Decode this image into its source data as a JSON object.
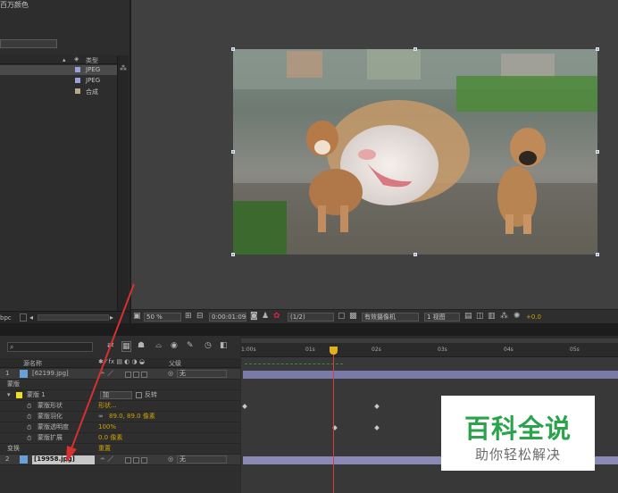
{
  "project": {
    "header_text": "百万颜色",
    "column_type": "类型",
    "items": [
      {
        "type": "JPEG",
        "color": "#9aa0d8"
      },
      {
        "type": "JPEG",
        "color": "#9aa0d8"
      },
      {
        "type": "合成",
        "color": "#b8a88a"
      }
    ],
    "bottom_label": "bpc"
  },
  "viewer": {
    "zoom": "50 %",
    "timecode": "0:00:01:09",
    "resolution": "(1/2)",
    "camera": "有效摄像机",
    "views": "1 视图",
    "exposure": "+0.0"
  },
  "timeline": {
    "search_placeholder": "",
    "columns": {
      "source_name": "源名称",
      "parent": "父级"
    },
    "ruler_ticks": [
      "1:00s",
      "01s",
      "02s",
      "03s",
      "04s",
      "05s"
    ],
    "rows": [
      {
        "kind": "layer",
        "num": "1",
        "name": "[62199.jpg]",
        "parent": "无"
      },
      {
        "kind": "group",
        "label": "蒙版"
      },
      {
        "kind": "mask",
        "label": "蒙版 1",
        "mode": "加",
        "invert": "反转"
      },
      {
        "kind": "prop",
        "label": "蒙版形状",
        "value": "形状..."
      },
      {
        "kind": "prop",
        "label": "蒙版羽化",
        "value": "89.0, 89.0 像素"
      },
      {
        "kind": "prop",
        "label": "蒙版透明度",
        "value": "100%"
      },
      {
        "kind": "prop",
        "label": "蒙版扩展",
        "value": "0.0 像素"
      },
      {
        "kind": "group",
        "label": "变换",
        "value": "重置"
      },
      {
        "kind": "layer",
        "num": "2",
        "name": "[19958.jpg]",
        "parent": "无"
      }
    ]
  },
  "watermark": {
    "title": "百科全说",
    "subtitle": "助你轻松解决"
  },
  "colors": {
    "accent_yellow": "#d0a000",
    "layer_bar": "#7a7aa8",
    "cti_red": "#d04040",
    "brand_green": "#2aa34a"
  }
}
